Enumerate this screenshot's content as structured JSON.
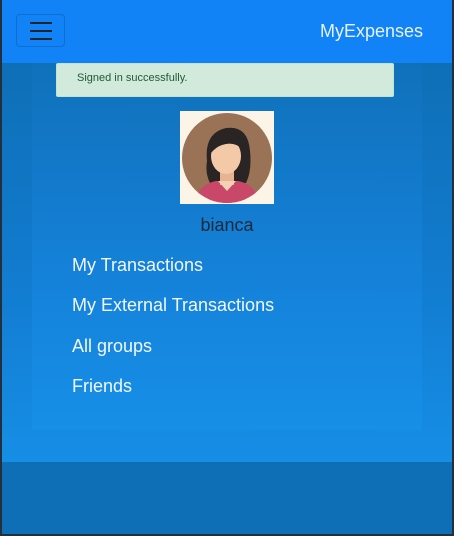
{
  "navbar": {
    "brand": "MyExpenses",
    "toggle_icon": "hamburger-icon"
  },
  "alert": {
    "message": "Signed in successfully."
  },
  "profile": {
    "avatar_icon": "user-avatar-icon",
    "username": "bianca"
  },
  "menu": {
    "items": [
      {
        "label": "My Transactions"
      },
      {
        "label": "My External Transactions"
      },
      {
        "label": "All groups"
      },
      {
        "label": "Friends"
      }
    ]
  },
  "colors": {
    "navbar": "#1183f7",
    "alert_bg": "#d2eadc",
    "alert_text": "#1f5a33",
    "avatar_bg": "#fcf4e6"
  }
}
